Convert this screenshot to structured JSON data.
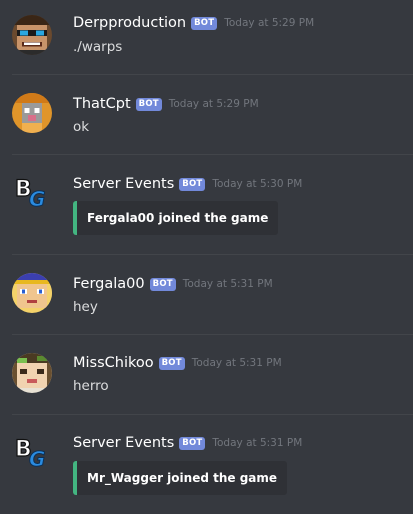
{
  "messages": [
    {
      "username": "Derpproduction",
      "bot": "BOT",
      "time": "Today at 5:29 PM",
      "content": "./warps"
    },
    {
      "username": "ThatCpt",
      "bot": "BOT",
      "time": "Today at 5:29 PM",
      "content": "ok"
    },
    {
      "username": "Server Events",
      "bot": "BOT",
      "time": "Today at 5:30 PM",
      "embed": "Fergala00 joined the game"
    },
    {
      "username": "Fergala00",
      "bot": "BOT",
      "time": "Today at 5:31 PM",
      "content": "hey"
    },
    {
      "username": "MissChikoo",
      "bot": "BOT",
      "time": "Today at 5:31 PM",
      "content": "herro"
    },
    {
      "username": "Server Events",
      "bot": "BOT",
      "time": "Today at 5:31 PM",
      "embed": "Mr_Wagger joined the game"
    }
  ],
  "colors": {
    "background": "#36393f",
    "bot_tag": "#7289da",
    "embed_bar": "#43b581",
    "embed_bg": "#2f3136"
  },
  "icons": [
    "derpproduction-avatar-icon",
    "thatcpt-avatar-icon",
    "server-events-logo-icon",
    "fergala00-avatar-icon",
    "misschikoo-avatar-icon",
    "server-events-logo-icon"
  ]
}
